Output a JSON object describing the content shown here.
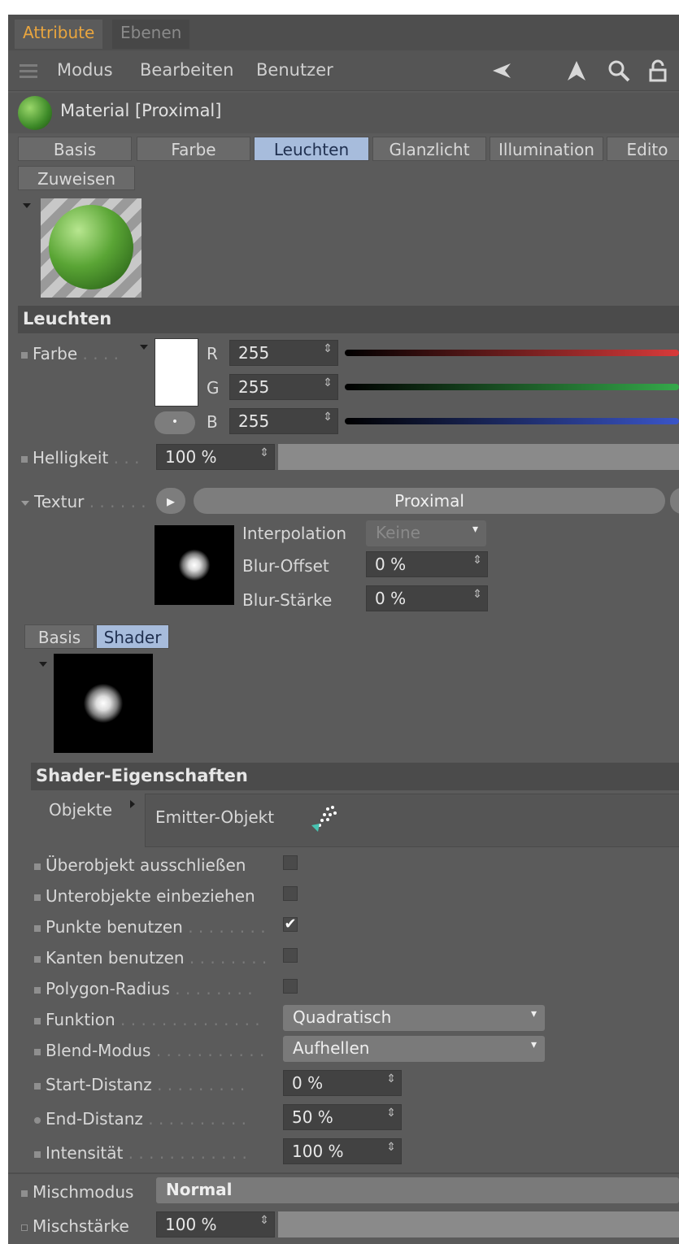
{
  "tabs": {
    "attribute": "Attribute",
    "ebenen": "Ebenen"
  },
  "menu": {
    "modus": "Modus",
    "bearbeiten": "Bearbeiten",
    "benutzer": "Benutzer"
  },
  "material_title": "Material [Proximal]",
  "material_tabs": [
    "Basis",
    "Farbe",
    "Leuchten",
    "Glanzlicht",
    "Illumination",
    "Edito"
  ],
  "assign_tab": "Zuweisen",
  "section_leuchten": "Leuchten",
  "farbe": {
    "label": "Farbe",
    "dots": ". . . .",
    "r_label": "R",
    "g_label": "G",
    "b_label": "B",
    "r": "255",
    "g": "255",
    "b": "255"
  },
  "helligkeit": {
    "label": "Helligkeit",
    "dots": ". . .",
    "value": "100 %"
  },
  "textur": {
    "label": "Textur",
    "dots": ". . . . . .",
    "button": "Proximal"
  },
  "interpolation": {
    "label": "Interpolation",
    "value": "Keine"
  },
  "blur_offset": {
    "label": "Blur-Offset",
    "value": "0 %"
  },
  "blur_staerke": {
    "label": "Blur-Stärke",
    "value": "0 %"
  },
  "sub_tabs": [
    "Basis",
    "Shader"
  ],
  "section_shader": "Shader-Eigenschaften",
  "objekte": {
    "label": "Objekte",
    "item": "Emitter-Objekt"
  },
  "options": [
    {
      "label": "Überobjekt ausschließen",
      "checked": false
    },
    {
      "label": "Unterobjekte einbeziehen",
      "checked": false
    },
    {
      "label": "Punkte benutzen",
      "dots": ". . . . . . . .",
      "checked": true
    },
    {
      "label": "Kanten benutzen",
      "dots": ". . . . . . . .",
      "checked": false
    },
    {
      "label": "Polygon-Radius",
      "dots": ". . . . . . . .",
      "checked": false
    }
  ],
  "funktion": {
    "label": "Funktion",
    "dots": ". . . . . . . . . . . . . .",
    "value": "Quadratisch"
  },
  "blend_modus": {
    "label": "Blend-Modus",
    "dots": ". . . . . . . . . . .",
    "value": "Aufhellen"
  },
  "start_distanz": {
    "label": "Start-Distanz",
    "dots": ". . . . . . . . .",
    "value": "0 %"
  },
  "end_distanz": {
    "label": "End-Distanz",
    "dots": ". . . . . . . . . .",
    "value": "50 %"
  },
  "intensitaet": {
    "label": "Intensität",
    "dots": ". . . . . . . . . . . .",
    "value": "100 %"
  },
  "mischmodus": {
    "label": "Mischmodus",
    "value": "Normal"
  },
  "mischstaerke": {
    "label": "Mischstärke",
    "value": "100 %"
  },
  "colors": {
    "accent_tab": "#e9a53e",
    "selected_tab": "#a7bcdc",
    "panel": "#5b5b5b",
    "red": "#d83a3a",
    "green": "#35a84a",
    "blue": "#3a55c8"
  }
}
